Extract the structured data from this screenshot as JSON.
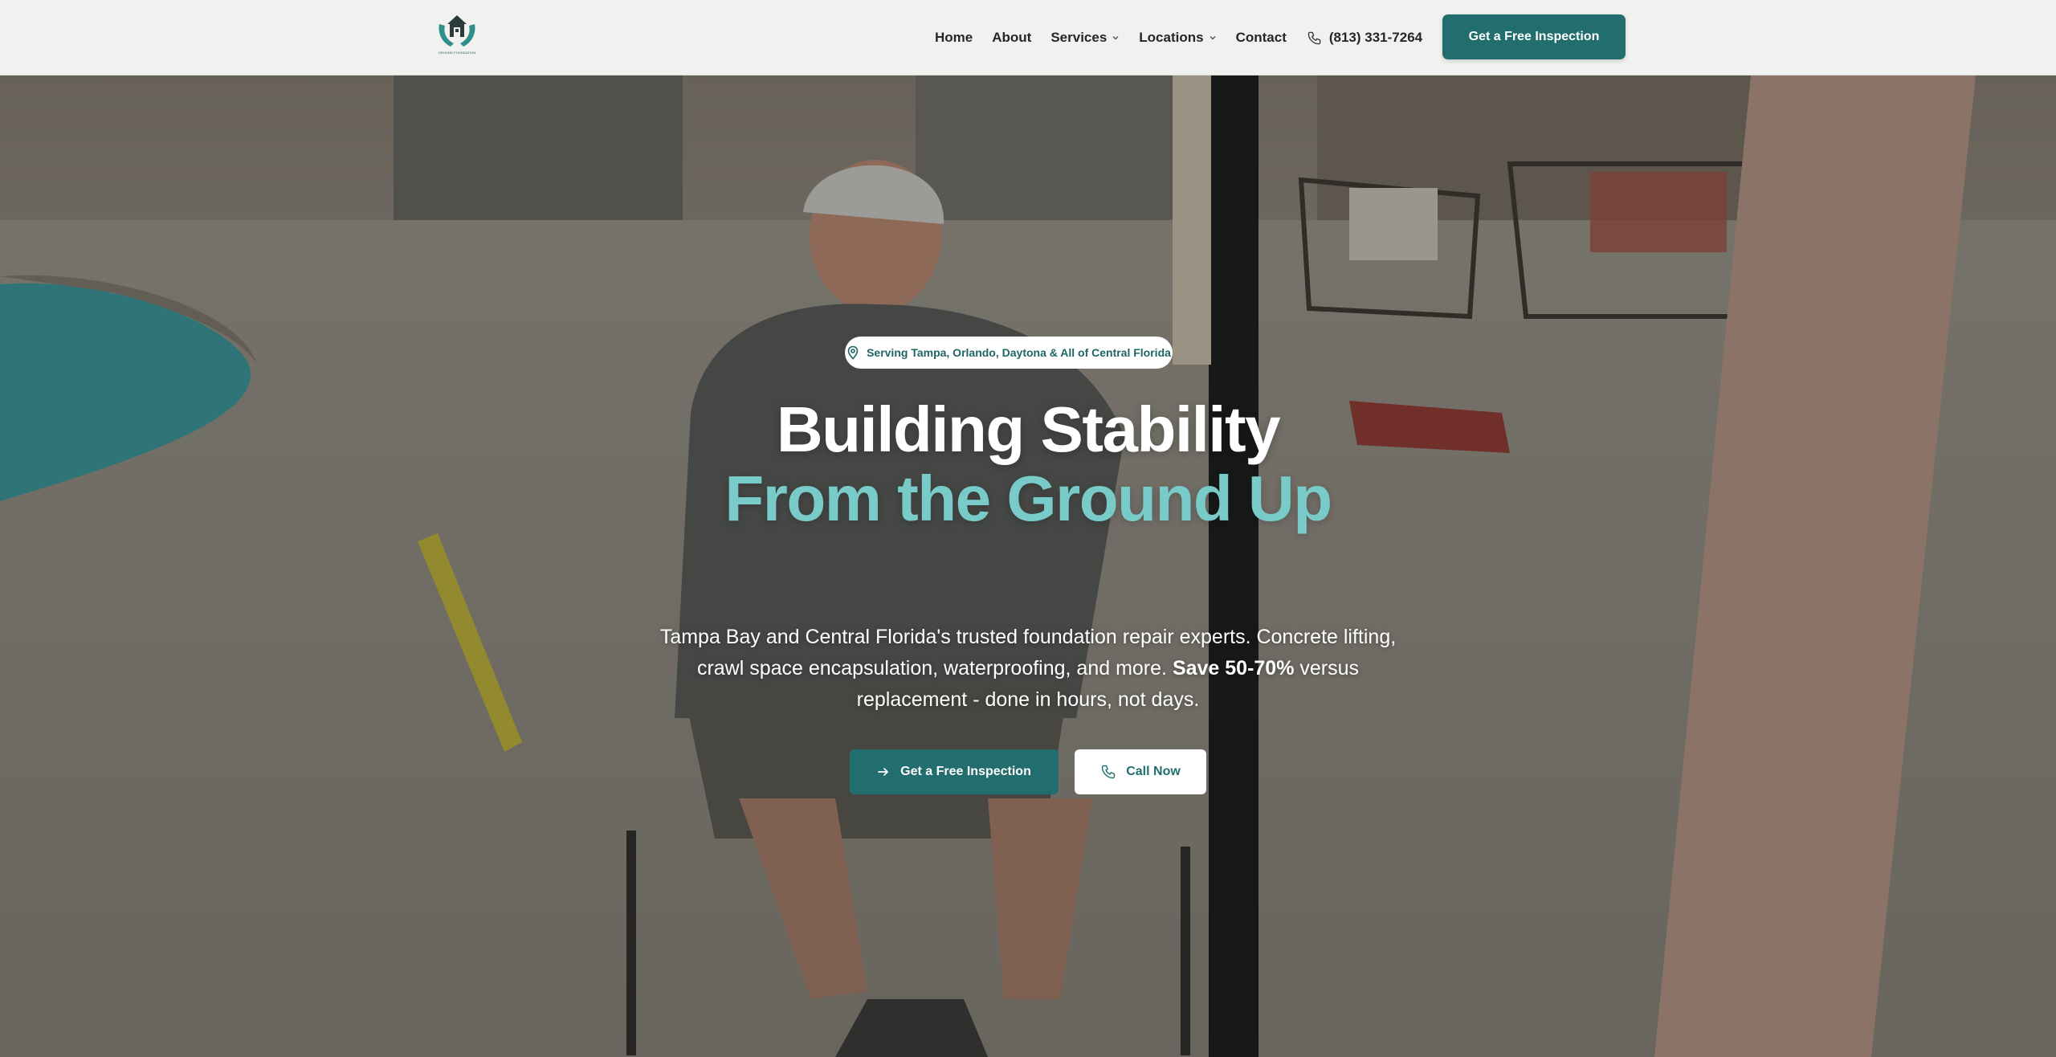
{
  "header": {
    "logo_alt": "Foundation repair company logo",
    "nav": [
      {
        "label": "Home",
        "has_dropdown": false
      },
      {
        "label": "About",
        "has_dropdown": false
      },
      {
        "label": "Services",
        "has_dropdown": true
      },
      {
        "label": "Locations",
        "has_dropdown": true
      },
      {
        "label": "Contact",
        "has_dropdown": false
      }
    ],
    "phone": "(813) 331-7264",
    "cta_label": "Get a Free Inspection"
  },
  "hero": {
    "badge_text": "Serving Tampa, Orlando, Daytona & All of Central Florida",
    "title_line_1": "Building Stability",
    "title_line_2": "From the Ground Up",
    "subtitle_part_1": "Tampa Bay and Central Florida's trusted foundation repair experts. Concrete lifting, crawl space encapsulation, waterproofing, and more.",
    "subtitle_bold": "Save 50-70%",
    "subtitle_part_2": "versus replacement - done in hours, not days.",
    "primary_button_label": "Get a Free Inspection",
    "secondary_button_label": "Call Now"
  },
  "colors": {
    "brand_teal": "#226e6e",
    "accent_teal_light": "#78cbc8",
    "header_bg": "#f1f1ef"
  },
  "icons": {
    "phone": "phone-icon",
    "location": "map-pin-icon",
    "arrow": "arrow-right-icon",
    "chevron": "chevron-down-icon"
  }
}
